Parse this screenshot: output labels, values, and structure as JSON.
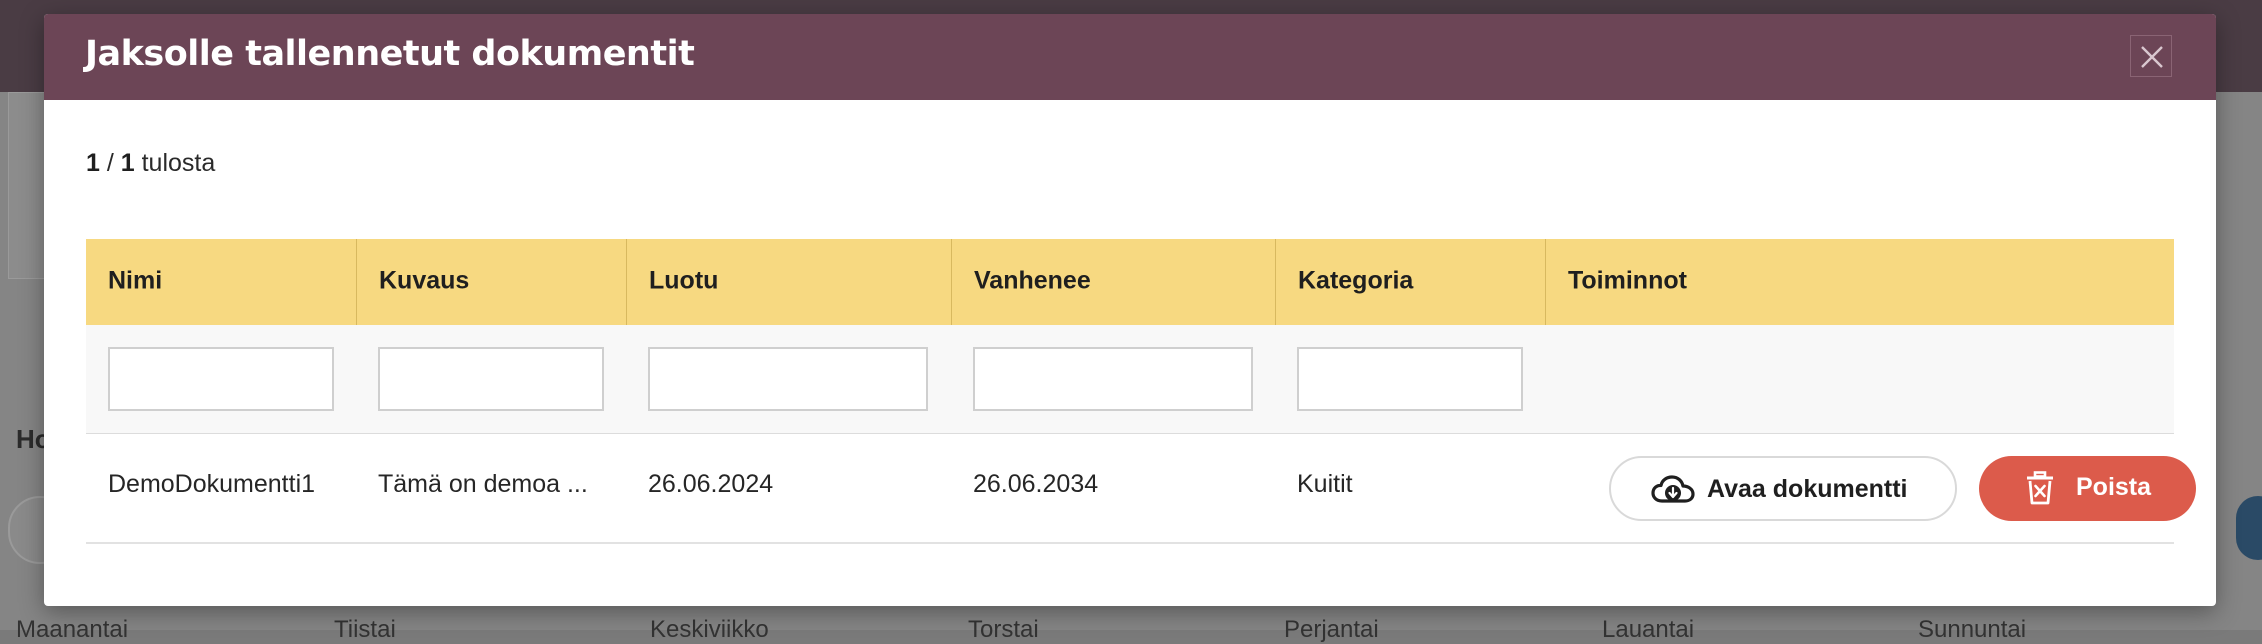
{
  "background": {
    "heading_fragment": "Ho",
    "columns": [
      "Maanantai",
      "Tiistai",
      "Keskiviikko",
      "Torstai",
      "Perjantai",
      "Lauantai",
      "Sunnuntai"
    ]
  },
  "modal": {
    "title": "Jaksolle tallennetut dokumentit",
    "close_icon": "close-icon",
    "result_count": {
      "current": "1",
      "separator": " / ",
      "total": "1",
      "suffix": " tulosta"
    },
    "table": {
      "headers": [
        "Nimi",
        "Kuvaus",
        "Luotu",
        "Vanhenee",
        "Kategoria",
        "Toiminnot"
      ],
      "filters": {
        "nimi": "",
        "kuvaus": "",
        "luotu": "",
        "vanhenee": "",
        "kategoria": ""
      },
      "rows": [
        {
          "nimi": "DemoDokumentti1",
          "kuvaus": "Tämä on demoa ...",
          "luotu": "26.06.2024",
          "vanhenee": "26.06.2034",
          "kategoria": "Kuitit",
          "actions": {
            "open_label": "Avaa dokumentti",
            "open_icon": "cloud-download-icon",
            "delete_label": "Poista",
            "delete_icon": "trash-icon"
          }
        }
      ]
    }
  },
  "colors": {
    "header": "#6c4556",
    "table_header": "#f7d981",
    "delete_button": "#dc5b4b"
  }
}
